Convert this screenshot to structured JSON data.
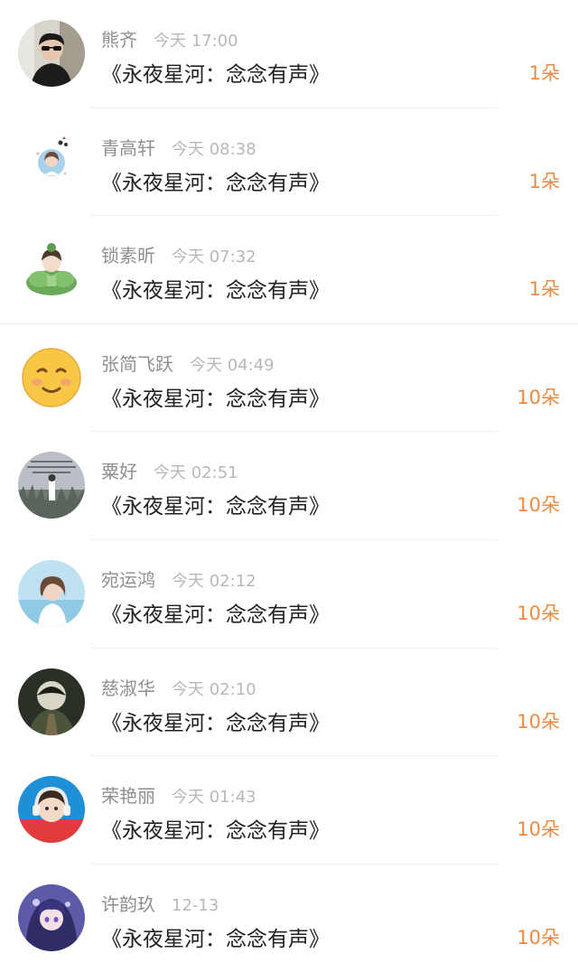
{
  "colors": {
    "count": "#ec8a42",
    "name": "#8f8f8f",
    "time": "#b8b8b8",
    "title": "#222222"
  },
  "items": [
    {
      "name": "熊齐",
      "time": "今天 17:00",
      "title": "《永夜星河：念念有声》",
      "count": "1朵",
      "avatar": "avatar-man-sunglasses"
    },
    {
      "name": "青高轩",
      "time": "今天 08:38",
      "title": "《永夜星河：念念有声》",
      "count": "1朵",
      "avatar": "avatar-girl-cartoon"
    },
    {
      "name": "锁素昕",
      "time": "今天 07:32",
      "title": "《永夜星河：念念有声》",
      "count": "1朵",
      "avatar": "avatar-lotus-girl"
    },
    {
      "name": "张简飞跃",
      "time": "今天 04:49",
      "title": "《永夜星河：念念有声》",
      "count": "10朵",
      "avatar": "avatar-emoji-face"
    },
    {
      "name": "粟好",
      "time": "今天 02:51",
      "title": "《永夜星河：念念有声》",
      "count": "10朵",
      "avatar": "avatar-grass-girl"
    },
    {
      "name": "宛运鸿",
      "time": "今天 02:12",
      "title": "《永夜星河：念念有声》",
      "count": "10朵",
      "avatar": "avatar-beach-girl"
    },
    {
      "name": "慈淑华",
      "time": "今天 02:10",
      "title": "《永夜星河：念念有声》",
      "count": "10朵",
      "avatar": "avatar-dark-art"
    },
    {
      "name": "荣艳丽",
      "time": "今天 01:43",
      "title": "《永夜星河：念念有声》",
      "count": "10朵",
      "avatar": "avatar-child-headphones"
    },
    {
      "name": "许韵玖",
      "time": "12-13",
      "title": "《永夜星河：念念有声》",
      "count": "10朵",
      "avatar": "avatar-anime-girl"
    }
  ]
}
